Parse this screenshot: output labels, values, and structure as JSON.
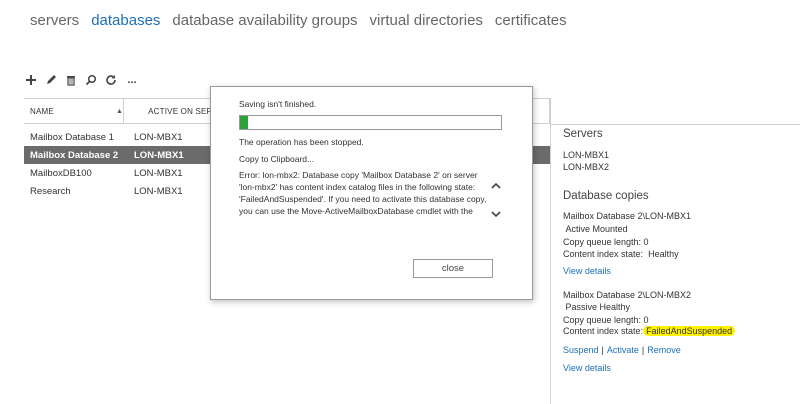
{
  "nav": {
    "items": [
      "servers",
      "databases",
      "database availability groups",
      "virtual directories",
      "certificates"
    ],
    "active": "databases"
  },
  "toolbar": {
    "icons": [
      "add-icon",
      "edit-icon",
      "delete-icon",
      "search-icon",
      "refresh-icon",
      "more-icon"
    ],
    "more_label": "..."
  },
  "table": {
    "headers": [
      "NAME",
      "ACTIVE ON SERVER"
    ],
    "sort_indicator": "▲",
    "rows": [
      {
        "name": "Mailbox Database 1",
        "server": "LON-MBX1"
      },
      {
        "name": "Mailbox Database 2",
        "server": "LON-MBX1"
      },
      {
        "name": "MailboxDB100",
        "server": "LON-MBX1"
      },
      {
        "name": "Research",
        "server": "LON-MBX1"
      }
    ],
    "selected_index": 1
  },
  "details": {
    "servers_heading": "Servers",
    "servers": [
      "LON-MBX1",
      "LON-MBX2"
    ],
    "copies_heading": "Database copies",
    "copy1": {
      "name": "Mailbox Database 2\\LON-MBX1",
      "status": "Active Mounted",
      "queue": "Copy queue length: 0",
      "index_label": "Content index state:",
      "index_value": "Healthy",
      "view_details": "View details"
    },
    "copy2": {
      "name": "Mailbox Database 2\\LON-MBX2",
      "status": "Passive Healthy",
      "queue": "Copy queue length: 0",
      "index_label": "Content index state:",
      "index_value": "FailedAndSuspended",
      "actions": [
        "Suspend",
        "Activate",
        "Remove"
      ],
      "view_details": "View details"
    }
  },
  "dialog": {
    "title": "Saving isn't finished.",
    "progress": 0.03,
    "stopped": "The operation has been stopped.",
    "copy_link": "Copy to Clipboard...",
    "error": "Error: lon-mbx2: Database copy 'Mailbox Database 2' on server 'lon-mbx2' has content index catalog files in the following state: 'FailedAndSuspended'. If you need to activate this database copy, you can use the Move-ActiveMailboxDatabase cmdlet with the",
    "close_label": "close"
  },
  "colors": {
    "accent": "#1e6fb5",
    "selected_row": "#6b6b6b",
    "progress": "#2da23b",
    "highlight": "#fff200"
  }
}
